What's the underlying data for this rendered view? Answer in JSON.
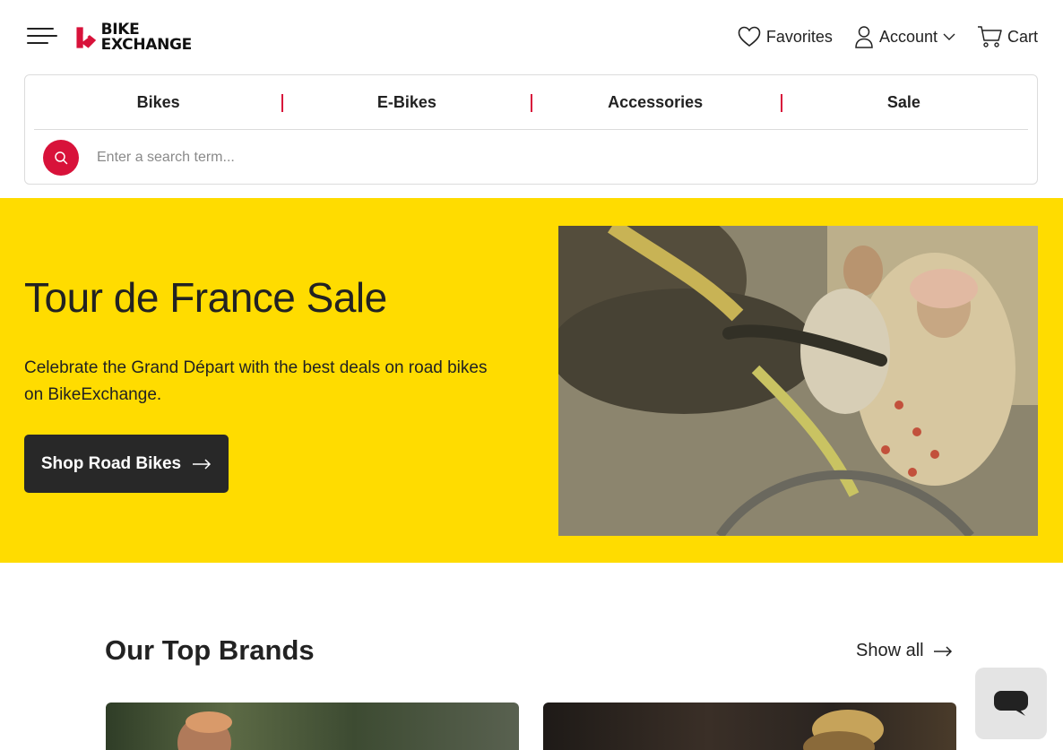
{
  "header": {
    "logo_line1": "BIKE",
    "logo_line2": "EXCHANGE",
    "favorites_label": "Favorites",
    "account_label": "Account",
    "cart_label": "Cart"
  },
  "nav": {
    "categories": [
      "Bikes",
      "E-Bikes",
      "Accessories",
      "Sale"
    ]
  },
  "search": {
    "placeholder": "Enter a search term..."
  },
  "hero": {
    "title": "Tour de France Sale",
    "subtitle": "Celebrate the Grand Départ with the best deals on road bikes on BikeExchange.",
    "cta_label": "Shop Road Bikes"
  },
  "brands": {
    "title": "Our Top Brands",
    "show_all_label": "Show all"
  },
  "colors": {
    "accent": "#d8123a",
    "hero_background": "#ffdc00",
    "button_dark": "#282828"
  }
}
